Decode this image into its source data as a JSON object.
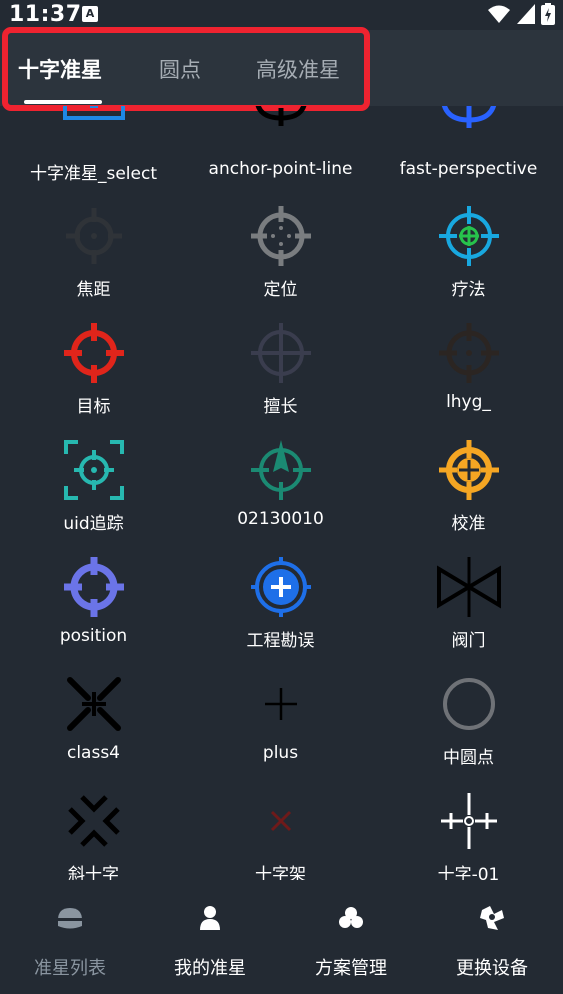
{
  "status_bar": {
    "time": "11:37",
    "app_icon_letter": "A"
  },
  "tabs": [
    {
      "label": "十字准星",
      "active": true
    },
    {
      "label": "圆点",
      "active": false
    },
    {
      "label": "高级准星",
      "active": false
    }
  ],
  "grid_items": [
    {
      "label": "十字准星_select",
      "icon": "crosshair-select-icon"
    },
    {
      "label": "anchor-point-line",
      "icon": "anchor-point-line-icon"
    },
    {
      "label": "fast-perspective",
      "icon": "fast-perspective-icon"
    },
    {
      "label": "焦距",
      "icon": "focus-crosshair-icon"
    },
    {
      "label": "定位",
      "icon": "locate-crosshair-icon"
    },
    {
      "label": "疗法",
      "icon": "therapy-crosshair-icon"
    },
    {
      "label": "目标",
      "icon": "target-crosshair-icon"
    },
    {
      "label": "擅长",
      "icon": "expert-crosshair-icon"
    },
    {
      "label": "lhyg_",
      "icon": "lhyg-crosshair-icon"
    },
    {
      "label": "uid追踪",
      "icon": "uid-tracking-icon"
    },
    {
      "label": "02130010",
      "icon": "arrow-crosshair-icon"
    },
    {
      "label": "校准",
      "icon": "calibrate-crosshair-icon"
    },
    {
      "label": "position",
      "icon": "position-crosshair-icon"
    },
    {
      "label": "工程勘误",
      "icon": "engineering-plus-icon"
    },
    {
      "label": "阀门",
      "icon": "valve-icon"
    },
    {
      "label": "class4",
      "icon": "class4-x-icon"
    },
    {
      "label": "plus",
      "icon": "plus-icon"
    },
    {
      "label": "中圆点",
      "icon": "medium-circle-icon"
    },
    {
      "label": "斜十字",
      "icon": "diagonal-cross-icon"
    },
    {
      "label": "十字架",
      "icon": "small-x-icon"
    },
    {
      "label": "十字-01",
      "icon": "cross-01-icon"
    }
  ],
  "bottom_nav": [
    {
      "label": "准星列表",
      "icon": "crosshair-list-icon",
      "active": true
    },
    {
      "label": "我的准星",
      "icon": "user-icon",
      "active": false
    },
    {
      "label": "方案管理",
      "icon": "scheme-icon",
      "active": false
    },
    {
      "label": "更换设备",
      "icon": "device-icon",
      "active": false
    }
  ],
  "colors": {
    "background": "#232a33",
    "tabbar": "#2c343d",
    "highlight": "#ef2330",
    "inactive_nav": "#8a95a0"
  }
}
